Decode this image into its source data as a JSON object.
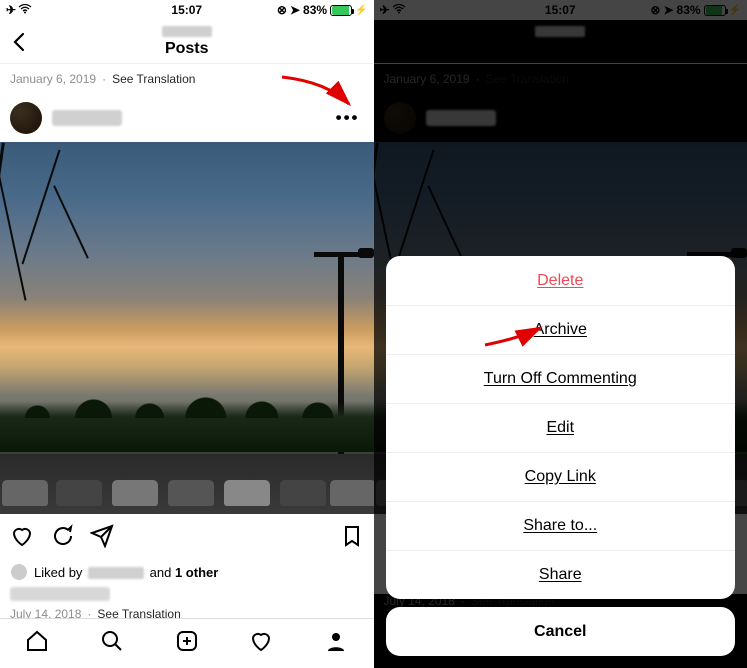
{
  "status": {
    "time": "15:07",
    "battery_pct": "83%"
  },
  "header": {
    "title": "Posts"
  },
  "top_meta": {
    "date": "January 6, 2019",
    "see_translation": "See Translation"
  },
  "actions": {
    "liked_by_prefix": "Liked by ",
    "liked_by_suffix_and": " and ",
    "liked_by_other": "1 other"
  },
  "bottom_meta": {
    "date": "July 14, 2018",
    "see_translation": "See Translation"
  },
  "sheet": {
    "items": [
      {
        "label": "Delete",
        "destructive": true
      },
      {
        "label": "Archive",
        "destructive": false
      },
      {
        "label": "Turn Off Commenting",
        "destructive": false
      },
      {
        "label": "Edit",
        "destructive": false
      },
      {
        "label": "Copy Link",
        "destructive": false
      },
      {
        "label": "Share to...",
        "destructive": false
      },
      {
        "label": "Share",
        "destructive": false
      }
    ],
    "cancel": "Cancel"
  },
  "colors": {
    "destructive": "#ed4956",
    "battery_green": "#34c759"
  }
}
